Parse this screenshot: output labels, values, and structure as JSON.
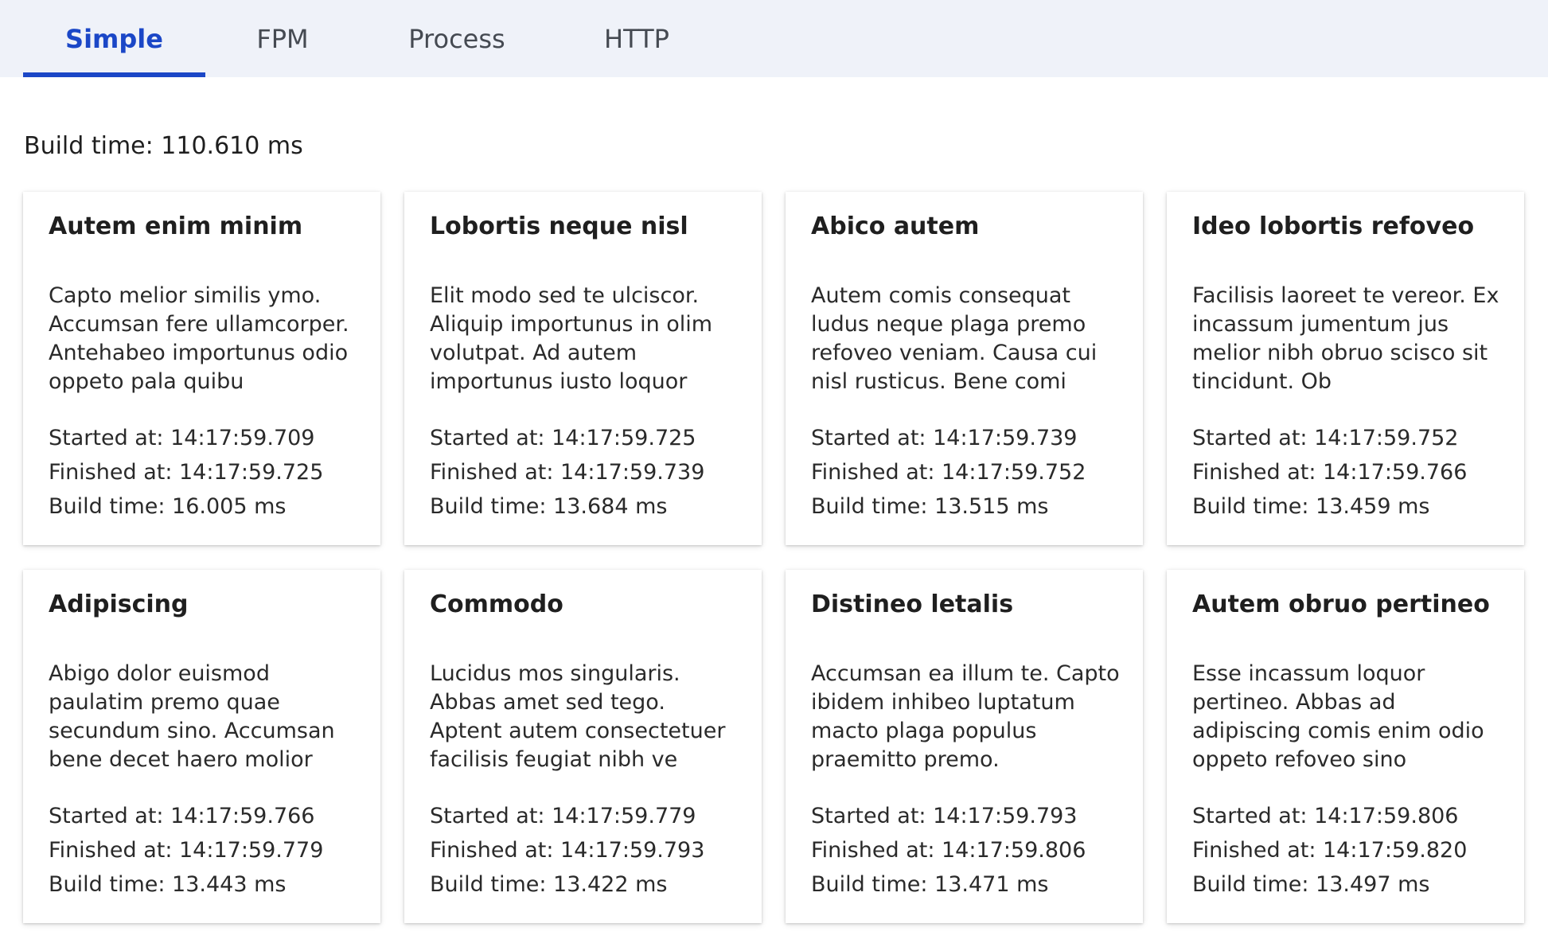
{
  "tabs": [
    {
      "label": "Simple",
      "active": true
    },
    {
      "label": "FPM",
      "active": false
    },
    {
      "label": "Process",
      "active": false
    },
    {
      "label": "HTTP",
      "active": false
    }
  ],
  "summary": {
    "build_time": "Build time: 110.610 ms"
  },
  "cards": [
    {
      "title": "Autem enim minim",
      "description": "Capto melior similis ymo. Accumsan fere ullamcorper. Antehabeo importunus odio oppeto pala quibu",
      "started": "Started at: 14:17:59.709",
      "finished": "Finished at: 14:17:59.725",
      "build_time": "Build time: 16.005 ms"
    },
    {
      "title": "Lobortis neque nisl",
      "description": "Elit modo sed te ulciscor. Aliquip importunus in olim volutpat. Ad autem importunus iusto loquor",
      "started": "Started at: 14:17:59.725",
      "finished": "Finished at: 14:17:59.739",
      "build_time": "Build time: 13.684 ms"
    },
    {
      "title": "Abico autem",
      "description": "Autem comis consequat ludus neque plaga premo refoveo veniam. Causa cui nisl rusticus. Bene comi",
      "started": "Started at: 14:17:59.739",
      "finished": "Finished at: 14:17:59.752",
      "build_time": "Build time: 13.515 ms"
    },
    {
      "title": "Ideo lobortis refoveo",
      "description": "Facilisis laoreet te vereor. Ex incassum jumentum jus melior nibh obruo scisco sit tincidunt. Ob",
      "started": "Started at: 14:17:59.752",
      "finished": "Finished at: 14:17:59.766",
      "build_time": "Build time: 13.459 ms"
    },
    {
      "title": "Adipiscing",
      "description": "Abigo dolor euismod paulatim premo quae secundum sino. Accumsan bene decet haero molior nimis si",
      "started": "Started at: 14:17:59.766",
      "finished": "Finished at: 14:17:59.779",
      "build_time": "Build time: 13.443 ms"
    },
    {
      "title": "Commodo",
      "description": "Lucidus mos singularis. Abbas amet sed tego. Aptent autem consectetuer facilisis feugiat nibh ve",
      "started": "Started at: 14:17:59.779",
      "finished": "Finished at: 14:17:59.793",
      "build_time": "Build time: 13.422 ms"
    },
    {
      "title": "Distineo letalis",
      "description": "Accumsan ea illum te. Capto ibidem inhibeo luptatum macto plaga populus praemitto premo.",
      "started": "Started at: 14:17:59.793",
      "finished": "Finished at: 14:17:59.806",
      "build_time": "Build time: 13.471 ms"
    },
    {
      "title": "Autem obruo pertineo",
      "description": "Esse incassum loquor pertineo. Abbas ad adipiscing comis enim odio oppeto refoveo sino tincidunt",
      "started": "Started at: 14:17:59.806",
      "finished": "Finished at: 14:17:59.820",
      "build_time": "Build time: 13.497 ms"
    }
  ],
  "colors": {
    "accent": "#1b47c7",
    "tabbar_bg": "#eff2f9",
    "inactive_tab": "#454a52"
  }
}
